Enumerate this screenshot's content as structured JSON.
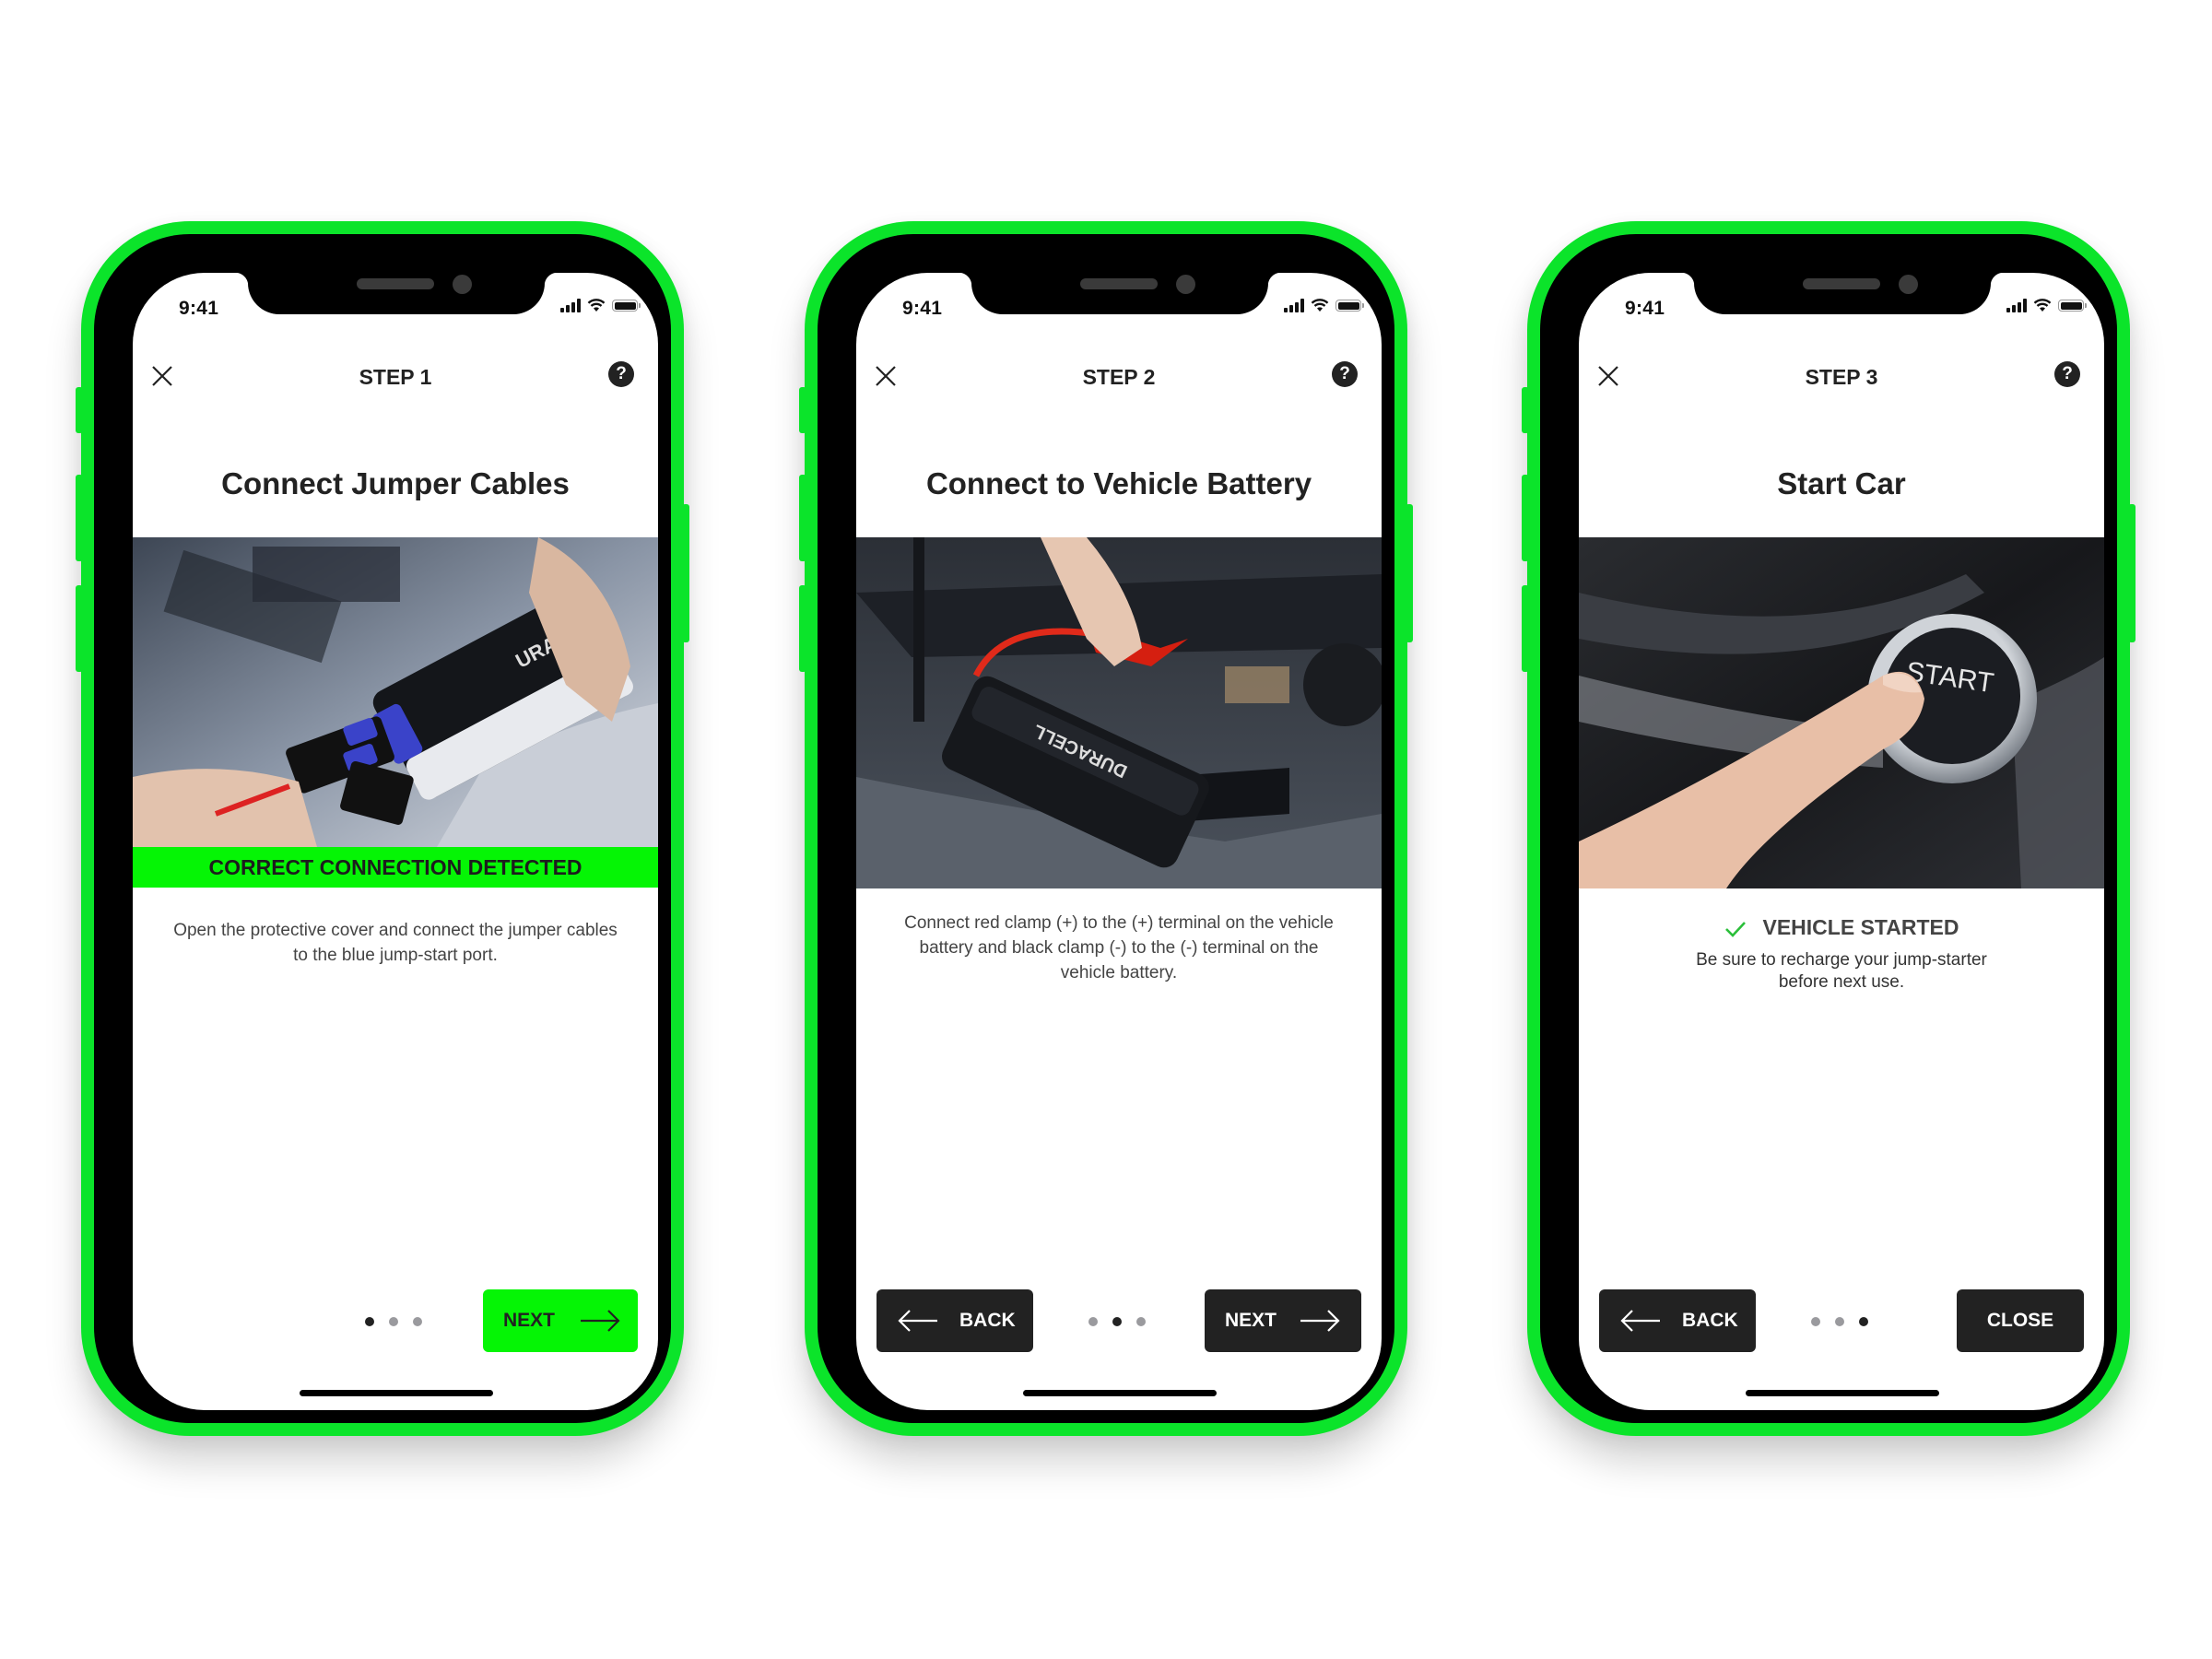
{
  "theme": {
    "accent": "#05f505",
    "frame": "#0be42a",
    "dark_button": "#222222",
    "check": "#2bbf3a"
  },
  "screens": [
    {
      "status_time": "9:41",
      "step_label": "STEP 1",
      "title": "Connect Jumper Cables",
      "photo_alt": "hands connecting jumper cable connector to blue jump-start port on jump starter",
      "banner": "CORRECT CONNECTION DETECTED",
      "description": "Open the protective cover and connect the jumper cables to the blue jump-start port.",
      "pagination": {
        "current": 1,
        "total": 3
      },
      "next_label": "NEXT"
    },
    {
      "status_time": "9:41",
      "step_label": "STEP 2",
      "title": "Connect to Vehicle Battery",
      "photo_alt": "hand attaching red clamp to vehicle battery, jump starter on engine cover",
      "description": "Connect red clamp (+) to the (+) terminal on the vehicle battery and black clamp (-) to the (-) terminal on the vehicle battery.",
      "pagination": {
        "current": 2,
        "total": 3
      },
      "back_label": "BACK",
      "next_label": "NEXT"
    },
    {
      "status_time": "9:41",
      "step_label": "STEP 3",
      "title": "Start Car",
      "photo_alt": "finger pressing START STOP engine button",
      "result_label": "VEHICLE STARTED",
      "description": "Be sure to recharge your jump-starter before next use.",
      "pagination": {
        "current": 3,
        "total": 3
      },
      "back_label": "BACK",
      "close_label": "CLOSE"
    }
  ]
}
